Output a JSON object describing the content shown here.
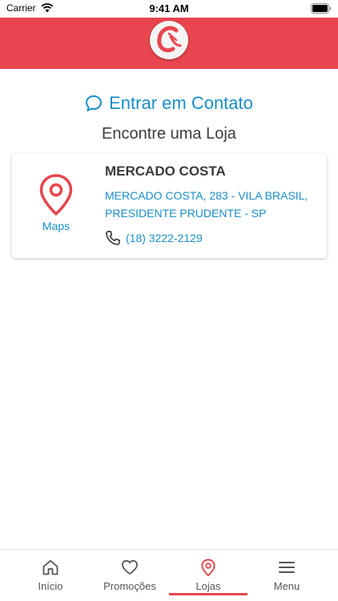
{
  "status_bar": {
    "carrier": "Carrier",
    "time": "9:41 AM"
  },
  "header": {
    "logo_letter": "C",
    "brand_color": "#e8454e"
  },
  "contact": {
    "label": "Entrar em Contato",
    "icon": "chat-bubble-icon"
  },
  "section": {
    "title": "Encontre uma Loja"
  },
  "store": {
    "name": "MERCADO COSTA",
    "address": "MERCADO COSTA, 283 - VILA BRASIL, PRESIDENTE PRUDENTE - SP",
    "phone": "(18) 3222-2129",
    "maps_label": "Maps"
  },
  "tabs": [
    {
      "label": "Início",
      "icon": "home-icon"
    },
    {
      "label": "Promoções",
      "icon": "heart-icon"
    },
    {
      "label": "Lojas",
      "icon": "location-pin-icon",
      "active": true
    },
    {
      "label": "Menu",
      "icon": "hamburger-menu-icon"
    }
  ],
  "colors": {
    "accent": "#1a8ec9",
    "red": "#e8454e",
    "text": "#3a3a3a"
  }
}
